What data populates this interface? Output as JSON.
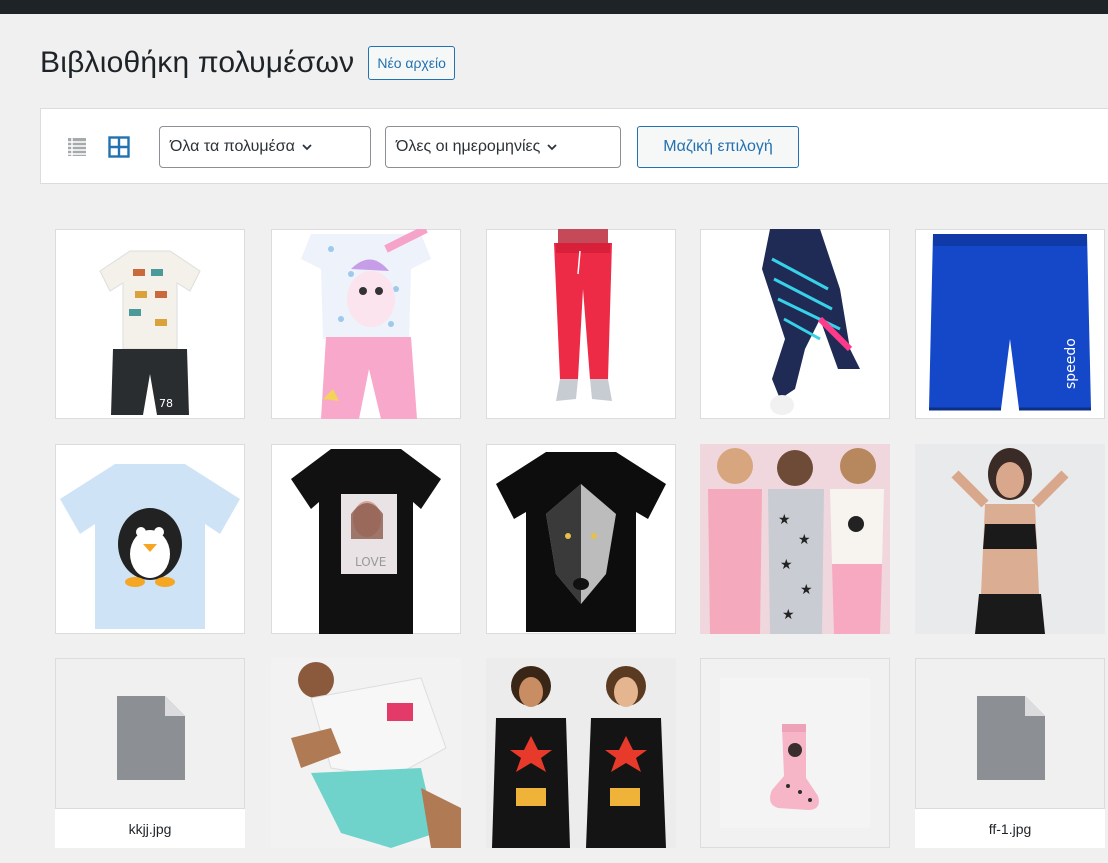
{
  "page": {
    "title": "Βιβλιοθήκη πολυμέσων",
    "new_button": "Νέο αρχείο"
  },
  "toolbar": {
    "view_modes": [
      {
        "name": "list",
        "icon": "list-view-icon",
        "active": false
      },
      {
        "name": "grid",
        "icon": "grid-view-icon",
        "active": true
      }
    ],
    "type_filter": "Όλα τα πολυμέσα",
    "date_filter": "Όλες οι ημερομηνίες",
    "bulk_select": "Μαζική επιλογή"
  },
  "colors": {
    "accent": "#2271b1",
    "background": "#f0f0f1",
    "dark_bar": "#1d2327"
  },
  "media": {
    "items": [
      {
        "kind": "image",
        "depicts": "kids tshirt with animals and black shorts"
      },
      {
        "kind": "image",
        "depicts": "unicorn tshirt with pink leggings"
      },
      {
        "kind": "image",
        "depicts": "red jogger pants"
      },
      {
        "kind": "image",
        "depicts": "printed sports leggings"
      },
      {
        "kind": "image",
        "depicts": "blue swim shorts"
      },
      {
        "kind": "image",
        "depicts": "light blue penguin tshirt"
      },
      {
        "kind": "image",
        "depicts": "black tshirt with girl print"
      },
      {
        "kind": "image",
        "depicts": "black wolf tshirt"
      },
      {
        "kind": "image",
        "depicts": "three kids in pyjamas"
      },
      {
        "kind": "image",
        "depicts": "woman in sports bra"
      },
      {
        "kind": "file",
        "filename": "kkjj.jpg"
      },
      {
        "kind": "image",
        "depicts": "man in white tshirt and aqua shorts"
      },
      {
        "kind": "image",
        "depicts": "two people in black printed tshirts"
      },
      {
        "kind": "image",
        "depicts": "pink sock"
      },
      {
        "kind": "file",
        "filename": "ff-1.jpg"
      }
    ]
  }
}
